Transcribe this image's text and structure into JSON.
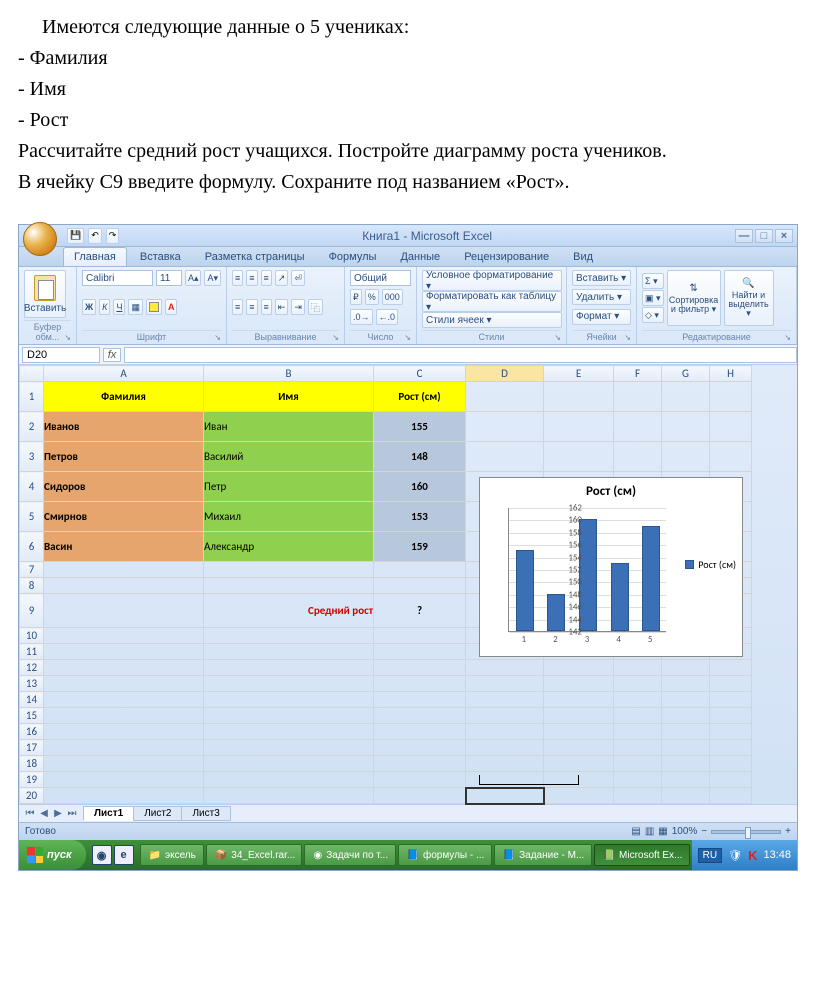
{
  "doc": {
    "l1": "Имеются следующие данные о 5 учениках:",
    "l2": "- Фамилия",
    "l3": "- Имя",
    "l4": "- Рост",
    "l5": "Рассчитайте средний рост учащихся. Постройте диаграмму роста учеников.",
    "l6": "В ячейку С9 введите формулу. Сохраните под названием «Рост»."
  },
  "excel": {
    "title": "Книга1 - Microsoft Excel",
    "tabs": [
      "Главная",
      "Вставка",
      "Разметка страницы",
      "Формулы",
      "Данные",
      "Рецензирование",
      "Вид"
    ],
    "ribbon": {
      "clipboard": {
        "paste": "Вставить",
        "title": "Буфер обм..."
      },
      "font": {
        "name": "Calibri",
        "size": "11",
        "title": "Шрифт"
      },
      "align": {
        "title": "Выравнивание"
      },
      "number": {
        "fmt": "Общий",
        "percent": "%",
        "thousand": "000",
        "title": "Число"
      },
      "styles": {
        "cond": "Условное форматирование ▾",
        "table": "Форматировать как таблицу ▾",
        "cell": "Стили ячеек ▾",
        "title": "Стили"
      },
      "cells": {
        "ins": "Вставить ▾",
        "del": "Удалить ▾",
        "fmt": "Формат ▾",
        "title": "Ячейки"
      },
      "editing": {
        "sigma": "Σ ▾",
        "fill": "▣ ▾",
        "clear": "◇ ▾",
        "sort": "Сортировка и фильтр ▾",
        "find": "Найти и выделить ▾",
        "title": "Редактирование"
      }
    },
    "namebox": "D20",
    "fx": "fx",
    "cols": [
      "A",
      "B",
      "C",
      "D",
      "E",
      "F",
      "G",
      "H"
    ],
    "rows": [
      "1",
      "2",
      "3",
      "4",
      "5",
      "6",
      "7",
      "8",
      "9",
      "10",
      "11",
      "12",
      "13",
      "14",
      "15",
      "16",
      "17",
      "18",
      "19",
      "20"
    ],
    "data": {
      "head": {
        "a": "Фамилия",
        "b": "Имя",
        "c": "Рост (см)"
      },
      "r": [
        {
          "fam": "Иванов",
          "nam": "Иван",
          "rost": "155"
        },
        {
          "fam": "Петров",
          "nam": "Василий",
          "rost": "148"
        },
        {
          "fam": "Сидоров",
          "nam": "Петр",
          "rost": "160"
        },
        {
          "fam": "Смирнов",
          "nam": "Михаил",
          "rost": "153"
        },
        {
          "fam": "Васин",
          "nam": "Александр",
          "rost": "159"
        }
      ],
      "avg_label": "Средний рост",
      "avg_val": "?"
    },
    "sheets": [
      "Лист1",
      "Лист2",
      "Лист3"
    ],
    "status": {
      "ready": "Готово",
      "zoom": "100%"
    }
  },
  "chart_data": {
    "type": "bar",
    "title": "Рост (см)",
    "categories": [
      "1",
      "2",
      "3",
      "4",
      "5"
    ],
    "values": [
      155,
      148,
      160,
      153,
      159
    ],
    "ylim": [
      142,
      162
    ],
    "yticks": [
      142,
      144,
      146,
      148,
      150,
      152,
      154,
      156,
      158,
      160,
      162
    ],
    "legend": "Рост (см)",
    "xlabel": "",
    "ylabel": ""
  },
  "taskbar": {
    "start": "пуск",
    "items": [
      "эксель",
      "34_Excel.rar...",
      "Задачи по т...",
      "формулы - ...",
      "Задание - M...",
      "Microsoft Ex..."
    ],
    "lang": "RU",
    "clock": "13:48"
  }
}
